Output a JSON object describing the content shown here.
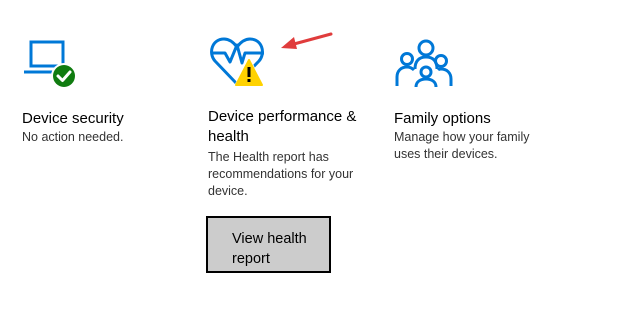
{
  "cards": [
    {
      "icon": "laptop-check-icon",
      "title": "Device security",
      "description": "No action needed."
    },
    {
      "icon": "heart-warning-icon",
      "title": "Device performance & health",
      "description": "The Health report has recommendations for your device.",
      "button_label": "View health report"
    },
    {
      "icon": "family-icon",
      "title": "Family options",
      "description": "Manage how your family uses their devices."
    }
  ],
  "colors": {
    "icon_blue": "#0078d7",
    "check_green": "#107c10",
    "warning_yellow": "#ffd200",
    "arrow_red": "#e03c3c",
    "button_bg": "#cccccc"
  }
}
